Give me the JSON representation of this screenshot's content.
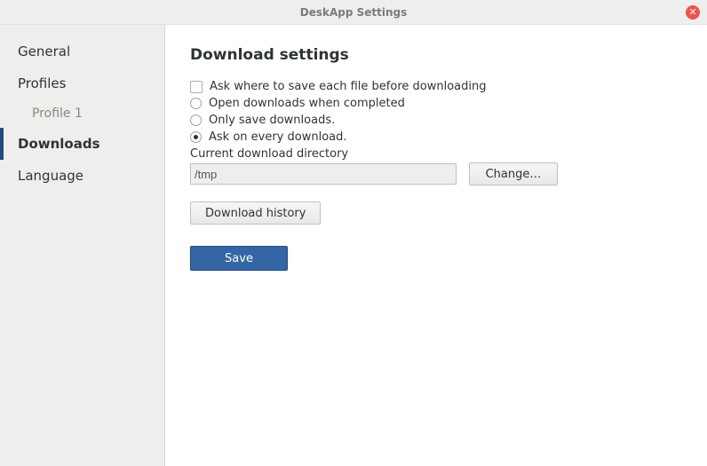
{
  "window": {
    "title": "DeskApp Settings"
  },
  "sidebar": {
    "general": "General",
    "profiles": "Profiles",
    "profile1": "Profile 1",
    "downloads": "Downloads",
    "language": "Language"
  },
  "main": {
    "header": "Download settings",
    "ask_where": "Ask where to save each file before downloading",
    "open_completed": "Open downloads when completed",
    "only_save": "Only save downloads.",
    "ask_every": "Ask on every download.",
    "dir_label": "Current download directory",
    "dir_value": "/tmp",
    "change_btn": "Change…",
    "history_btn": "Download history",
    "save_btn": "Save"
  }
}
